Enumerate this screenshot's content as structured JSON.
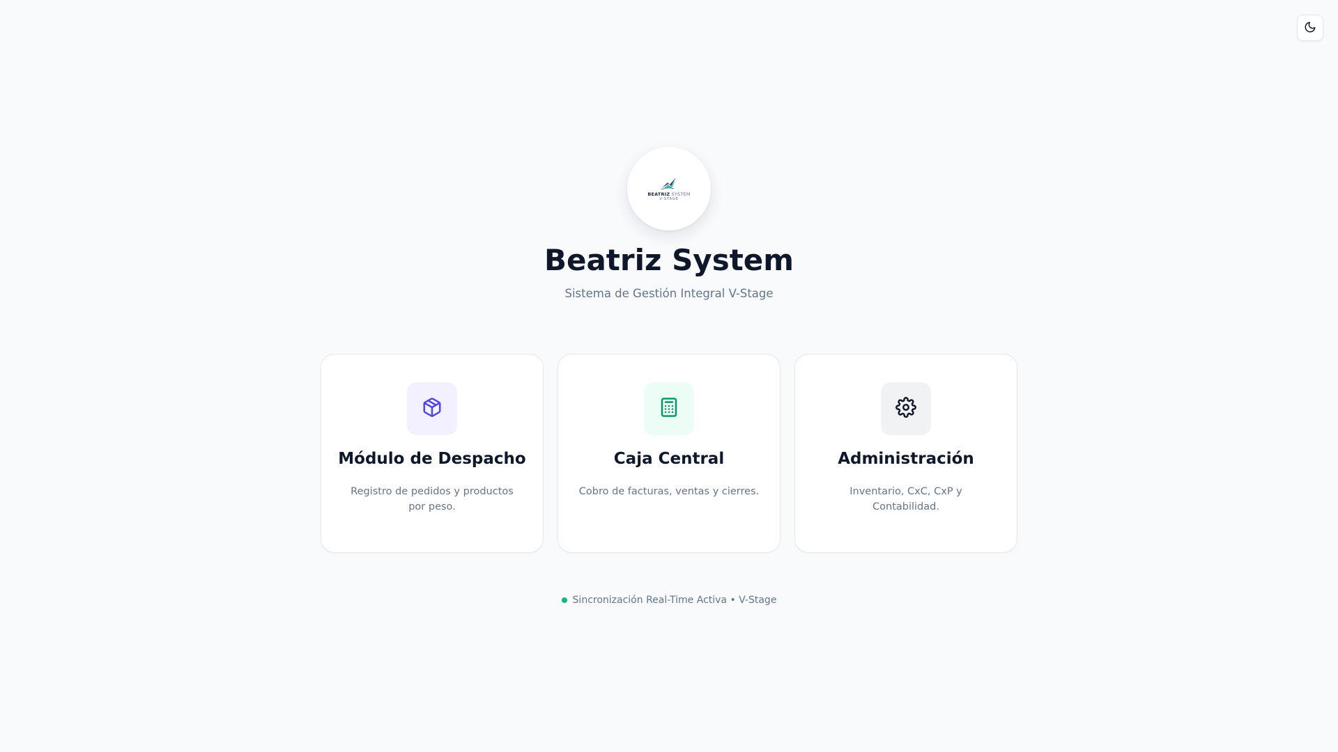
{
  "header": {
    "theme_toggle_icon": "moon-icon"
  },
  "logo": {
    "brand_bold": "BEATRIZ",
    "brand_light": "SYSTEM",
    "brand_sub": "V-STAGE",
    "icon": "bird-logo-icon"
  },
  "hero": {
    "title": "Beatriz System",
    "subtitle": "Sistema de Gestión Integral V-Stage"
  },
  "modules": [
    {
      "icon": "package-icon",
      "icon_color": "#4f46e5",
      "icon_bg": "#f3f0ff",
      "title": "Módulo de Despacho",
      "description": "Registro de pedidos y productos por peso."
    },
    {
      "icon": "calculator-icon",
      "icon_color": "#059669",
      "icon_bg": "#ecfdf5",
      "title": "Caja Central",
      "description": "Cobro de facturas, ventas y cierres."
    },
    {
      "icon": "gear-icon",
      "icon_color": "#111827",
      "icon_bg": "#f1f2f4",
      "title": "Administración",
      "description": "Inventario, CxC, CxP y Contabilidad."
    }
  ],
  "status": {
    "text": "Sincronización Real-Time Activa • V-Stage",
    "dot_color": "#10b981"
  }
}
